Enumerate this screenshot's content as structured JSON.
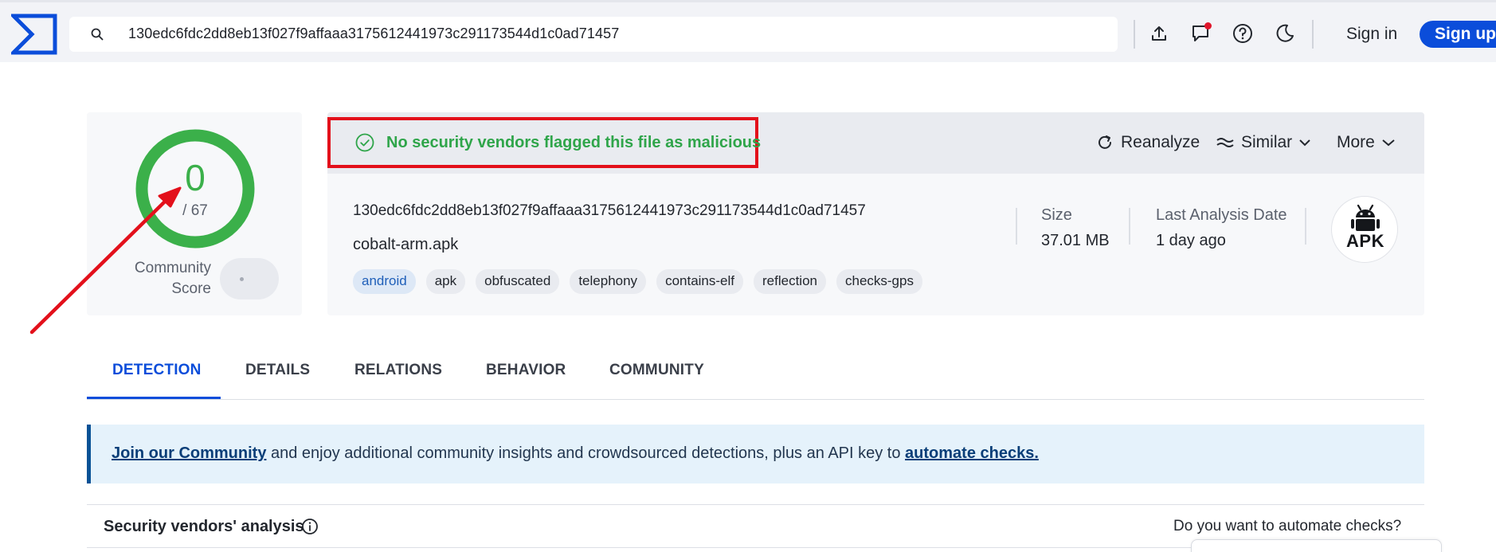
{
  "search": {
    "query": "130edc6fdc2dd8eb13f027f9affaaa3175612441973c291173544d1c0ad71457"
  },
  "topbar": {
    "signin_label": "Sign in",
    "signup_label": "Sign up"
  },
  "score": {
    "detections": "0",
    "total": "/ 67",
    "community_label_line1": "Community",
    "community_label_line2": "Score"
  },
  "verdict": {
    "text": "No security vendors flagged this file as malicious"
  },
  "actions": {
    "reanalyze": "Reanalyze",
    "similar": "Similar",
    "more": "More"
  },
  "file": {
    "hash": "130edc6fdc2dd8eb13f027f9affaaa3175612441973c291173544d1c0ad71457",
    "name": "cobalt-arm.apk",
    "tags": [
      "android",
      "apk",
      "obfuscated",
      "telephony",
      "contains-elf",
      "reflection",
      "checks-gps"
    ],
    "size_label": "Size",
    "size_value": "37.01 MB",
    "last_analysis_label": "Last Analysis Date",
    "last_analysis_value": "1 day ago",
    "type_badge": "APK"
  },
  "tabs": [
    "DETECTION",
    "DETAILS",
    "RELATIONS",
    "BEHAVIOR",
    "COMMUNITY"
  ],
  "banner": {
    "link1": "Join our Community",
    "middle": " and enjoy additional community insights and crowdsourced detections, plus an API key to ",
    "link2": "automate checks."
  },
  "vendors": {
    "title": "Security vendors' analysis",
    "automate_question": "Do you want to automate checks?"
  },
  "colors": {
    "accent_blue": "#0b4dda",
    "clean_green": "#3bb04a",
    "annotation_red": "#e3101b"
  }
}
